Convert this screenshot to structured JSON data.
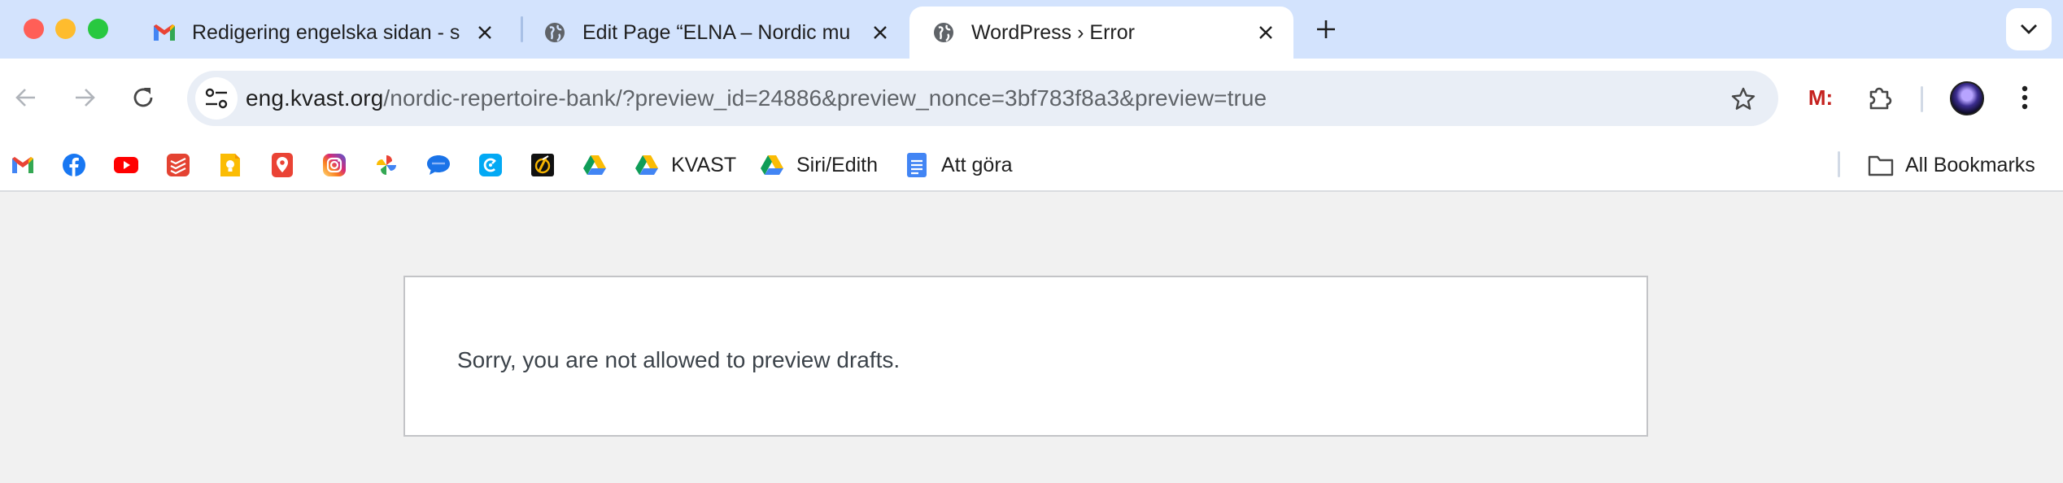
{
  "browser": {
    "tabs": [
      {
        "title": "Redigering engelska sidan - s",
        "favicon": "gmail-icon",
        "active": false
      },
      {
        "title": "Edit Page “ELNA – Nordic mu",
        "favicon": "globe-icon",
        "active": false
      },
      {
        "title": "WordPress › Error",
        "favicon": "globe-icon",
        "active": true
      }
    ],
    "toolbar": {
      "url_host": "eng.kvast.org",
      "url_path": "/nordic-repertoire-bank/?preview_id=24886&preview_nonce=3bf783f8a3&preview=true",
      "extension_m_label": "M:"
    },
    "bookmarks": [
      {
        "label": "",
        "icon": "gmail-icon"
      },
      {
        "label": "",
        "icon": "facebook-icon"
      },
      {
        "label": "",
        "icon": "youtube-icon"
      },
      {
        "label": "",
        "icon": "todoist-icon"
      },
      {
        "label": "",
        "icon": "keep-icon"
      },
      {
        "label": "",
        "icon": "maps-pin-icon"
      },
      {
        "label": "",
        "icon": "instagram-icon"
      },
      {
        "label": "",
        "icon": "photos-icon"
      },
      {
        "label": "",
        "icon": "messages-icon"
      },
      {
        "label": "",
        "icon": "clockify-icon"
      },
      {
        "label": "",
        "icon": "app-logo-icon"
      },
      {
        "label": "",
        "icon": "google-drive-icon"
      },
      {
        "label": "KVAST",
        "icon": "google-drive-icon"
      },
      {
        "label": "Siri/Edith",
        "icon": "google-drive-icon"
      },
      {
        "label": "Att göra",
        "icon": "google-docs-icon"
      }
    ],
    "all_bookmarks_label": "All Bookmarks"
  },
  "page": {
    "error_message": "Sorry, you are not allowed to preview drafts."
  },
  "colors": {
    "tabstrip": "#d3e3fd",
    "omnibox": "#e9eef6",
    "page_bg": "#f1f1f1",
    "error_border": "#c3c4c7",
    "error_text": "#3c434a"
  }
}
